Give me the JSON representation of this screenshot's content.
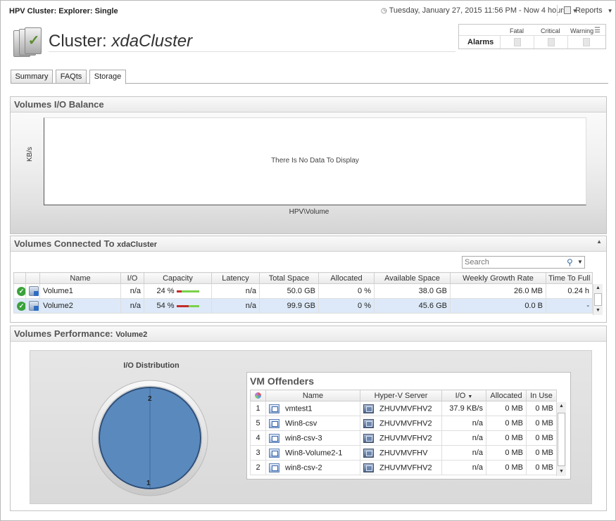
{
  "app": {
    "title": "HPV Cluster: Explorer: Single",
    "time_range": "Tuesday, January 27, 2015 11:56 PM - Now 4 hours",
    "reports_label": "Reports"
  },
  "header": {
    "title_prefix": "Cluster:",
    "cluster_name": "xdaCluster"
  },
  "alarms": {
    "label": "Alarms",
    "columns": [
      "Fatal",
      "Critical",
      "Warning"
    ]
  },
  "tabs": [
    {
      "label": "Summary",
      "active": false
    },
    {
      "label": "FAQts",
      "active": false
    },
    {
      "label": "Storage",
      "active": true
    }
  ],
  "io_balance": {
    "title": "Volumes I/O Balance",
    "empty_message": "There Is No Data To Display",
    "xlabel": "HPV\\Volume",
    "ylabel": "KB/s"
  },
  "volumes": {
    "title": "Volumes Connected To",
    "title_sub": "xdaCluster",
    "search_placeholder": "Search",
    "columns": [
      "Name",
      "I/O",
      "Capacity",
      "Latency",
      "Total Space",
      "Allocated",
      "Available Space",
      "Weekly Growth Rate",
      "Time To Full"
    ],
    "rows": [
      {
        "name": "Volume1",
        "io": "n/a",
        "capacity": "24 %",
        "capacity_value": 24,
        "latency": "n/a",
        "total": "50.0 GB",
        "allocated": "0 %",
        "available": "38.0 GB",
        "growth": "26.0 MB",
        "ttf": "0.24 h",
        "selected": false
      },
      {
        "name": "Volume2",
        "io": "n/a",
        "capacity": "54 %",
        "capacity_value": 54,
        "latency": "n/a",
        "total": "99.9 GB",
        "allocated": "0 %",
        "available": "45.6 GB",
        "growth": "0.0 B",
        "ttf": "-",
        "selected": true
      }
    ]
  },
  "performance": {
    "title": "Volumes Performance:",
    "title_sub": "Volume2",
    "io_distribution": {
      "title": "I/O Distribution",
      "top_label": "2",
      "bottom_label": "1",
      "color": "#5a8abd"
    },
    "vm_offenders": {
      "title": "VM Offenders",
      "columns": [
        "Name",
        "Hyper-V Server",
        "I/O",
        "Allocated",
        "In Use"
      ],
      "rows": [
        {
          "rank": "1",
          "name": "vmtest1",
          "server": "ZHUVMVFHV2",
          "io": "37.9 KB/s",
          "allocated": "0 MB",
          "in_use": "0 MB"
        },
        {
          "rank": "5",
          "name": "Win8-csv",
          "server": "ZHUVMVFHV2",
          "io": "n/a",
          "allocated": "0 MB",
          "in_use": "0 MB"
        },
        {
          "rank": "4",
          "name": "win8-csv-3",
          "server": "ZHUVMVFHV2",
          "io": "n/a",
          "allocated": "0 MB",
          "in_use": "0 MB"
        },
        {
          "rank": "3",
          "name": "Win8-Volume2-1",
          "server": "ZHUVMVFHV",
          "io": "n/a",
          "allocated": "0 MB",
          "in_use": "0 MB"
        },
        {
          "rank": "2",
          "name": "win8-csv-2",
          "server": "ZHUVMVFHV2",
          "io": "n/a",
          "allocated": "0 MB",
          "in_use": "0 MB"
        }
      ]
    }
  }
}
